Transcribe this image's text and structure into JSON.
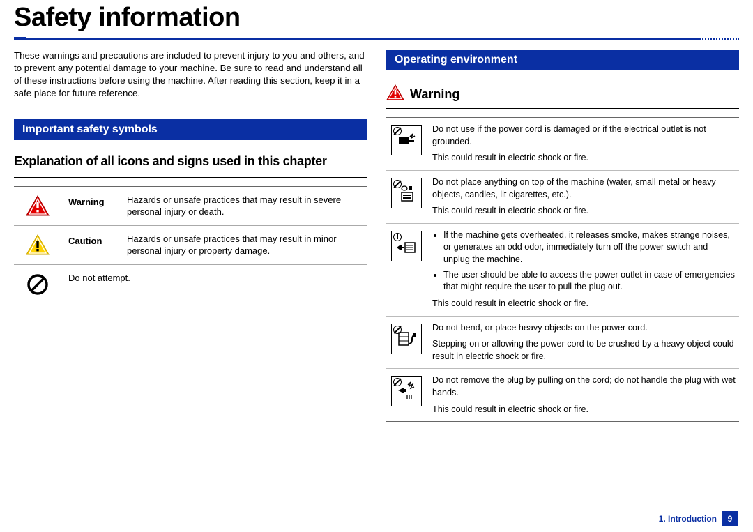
{
  "title": "Safety information",
  "intro": "These warnings and precautions are included to prevent injury to you and others, and to prevent any potential damage to your machine. Be sure to read and understand all of these instructions before using the machine. After reading this section, keep it in a safe place for future reference.",
  "left": {
    "sectionBar": "Important safety symbols",
    "subhead": "Explanation of all icons and signs used in this chapter",
    "rows": [
      {
        "label": "Warning",
        "desc": "Hazards or unsafe practices that may result in severe personal injury or death."
      },
      {
        "label": "Caution",
        "desc": "Hazards or unsafe practices that may result in minor personal injury or property damage."
      },
      {
        "label": "",
        "desc": "Do not attempt."
      }
    ]
  },
  "right": {
    "sectionBar": "Operating environment",
    "warnHead": "Warning",
    "rows": [
      {
        "main": "Do not use if the power cord is damaged or if the electrical outlet is not grounded.",
        "result": "This could result in electric shock or fire.",
        "bullets": []
      },
      {
        "main": "Do not place anything on top of the machine (water, small metal or heavy objects, candles, lit cigarettes, etc.).",
        "result": "This could result in electric shock or fire.",
        "bullets": []
      },
      {
        "main": "",
        "result": "This could result in electric shock or fire.",
        "bullets": [
          "If the machine gets overheated, it releases smoke, makes strange noises, or generates an odd odor, immediately turn off the power switch and unplug the machine.",
          "The user should be able to access the power outlet in case of emergencies that might require the user to pull the plug out."
        ]
      },
      {
        "main": "Do not bend, or place heavy objects on the power cord.",
        "result": "Stepping on or allowing the power cord to be crushed by a heavy object could result in electric shock or fire.",
        "bullets": []
      },
      {
        "main": "Do not remove the plug by pulling on the cord; do not handle the plug with wet hands.",
        "result": "This could result in electric shock or fire.",
        "bullets": []
      }
    ]
  },
  "footer": {
    "chapter": "1. Introduction",
    "page": "9"
  }
}
